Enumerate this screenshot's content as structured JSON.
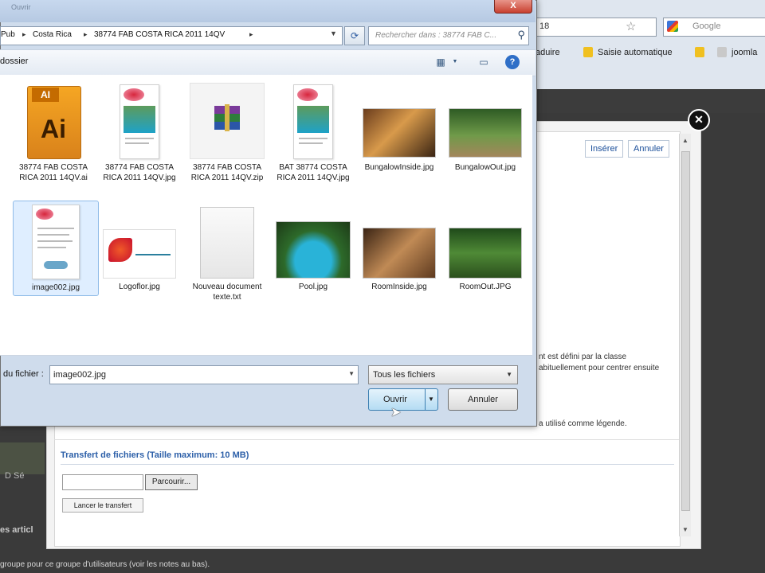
{
  "browser": {
    "address_fragment": "18",
    "search_placeholder": "Google",
    "toolbar_items": [
      "aduire",
      "Saisie automatique",
      "joomla"
    ]
  },
  "popup": {
    "insert_label": "Insérer",
    "cancel_label": "Annuler",
    "text_line_1": "nt est défini par la classe",
    "text_line_2": "abituellement pour centrer ensuite",
    "text_line_3": "a utilisé comme légende.",
    "upload_section_title": "Transfert de fichiers (Taille maximum: 10 MB)",
    "browse_label": "Parcourir...",
    "start_upload_label": "Lancer le transfert"
  },
  "background": {
    "left_text": "es articl",
    "bottom_text": "groupe pour ce groupe d'utilisateurs (voir les notes au bas).",
    "left_icons": "D  Sé"
  },
  "file_dialog": {
    "title_text": "Ouvrir",
    "close_symbol": "X",
    "breadcrumb": [
      "Pub",
      "Costa Rica",
      "38774 FAB COSTA RICA 2011 14QV"
    ],
    "search_placeholder": "Rechercher dans : 38774 FAB C...",
    "new_folder_label": "dossier",
    "files": [
      {
        "name": "38774 FAB COSTA RICA 2011 14QV.ai",
        "kind": "ai"
      },
      {
        "name": "38774 FAB COSTA RICA 2011 14QV.jpg",
        "kind": "doc"
      },
      {
        "name": "38774 FAB COSTA RICA 2011 14QV.zip",
        "kind": "zip"
      },
      {
        "name": "BAT 38774 COSTA RICA 2011 14QV.jpg",
        "kind": "doc"
      },
      {
        "name": "BungalowInside.jpg",
        "kind": "photo"
      },
      {
        "name": "BungalowOut.jpg",
        "kind": "photo"
      },
      {
        "name": "image002.jpg",
        "kind": "doc"
      },
      {
        "name": "Logoflor.jpg",
        "kind": "logo"
      },
      {
        "name": "Nouveau document texte.txt",
        "kind": "txt"
      },
      {
        "name": "Pool.jpg",
        "kind": "photo"
      },
      {
        "name": "RoomInside.jpg",
        "kind": "photo"
      },
      {
        "name": "RoomOut.JPG",
        "kind": "photo"
      }
    ],
    "file_label": "du fichier :",
    "file_value": "image002.jpg",
    "filetype_value": "Tous les fichiers",
    "open_label": "Ouvrir",
    "cancel_label": "Annuler",
    "ai_badge": "AI",
    "ai_text": "Ai"
  }
}
